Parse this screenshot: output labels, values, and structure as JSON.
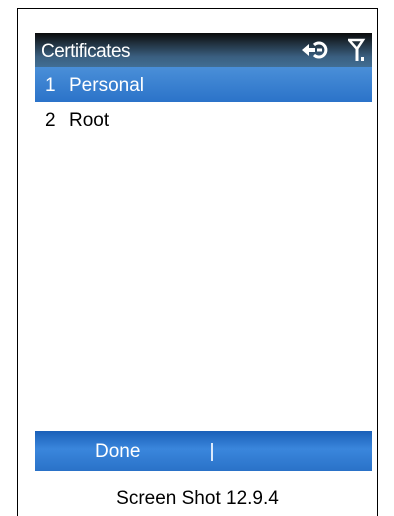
{
  "app": {
    "title": "Certificates",
    "status_icons": [
      "connection-icon",
      "signal-icon"
    ]
  },
  "list": {
    "items": [
      {
        "number": "1",
        "label": "Personal",
        "selected": true
      },
      {
        "number": "2",
        "label": "Root",
        "selected": false
      }
    ]
  },
  "softkeys": {
    "left_label": "Done"
  },
  "caption": "Screen Shot 12.9.4",
  "colors": {
    "selection": "#2f77cc",
    "softbar": "#2a72c8",
    "titlebar": "#416e94"
  }
}
